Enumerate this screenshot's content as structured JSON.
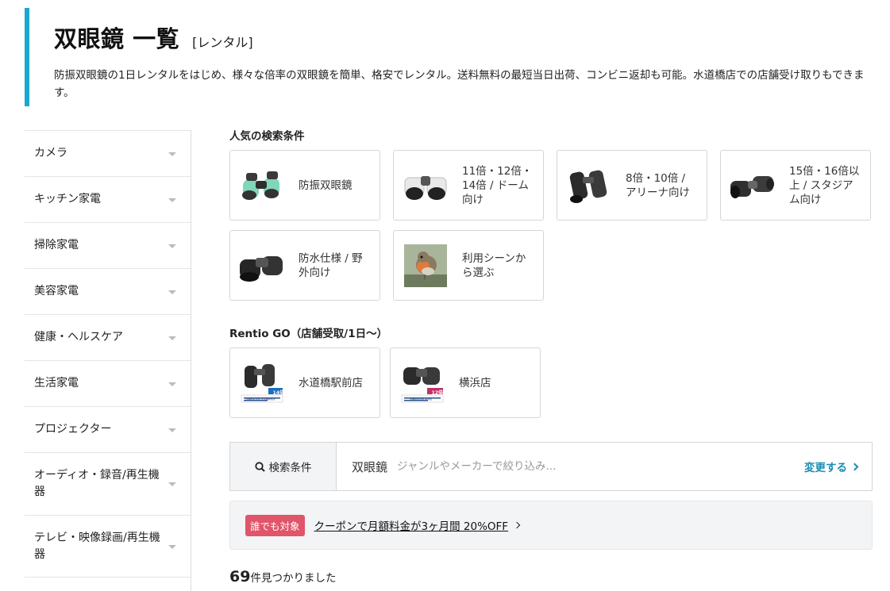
{
  "header": {
    "title": "双眼鏡 一覧",
    "tag": "[レンタル]",
    "description": "防振双眼鏡の1日レンタルをはじめ、様々な倍率の双眼鏡を簡単、格安でレンタル。送料無料の最短当日出荷、コンビニ返却も可能。水道橋店での店舗受け取りもできます。",
    "accent_color": "#1aa7d0"
  },
  "sidebar": {
    "items": [
      {
        "label": "カメラ"
      },
      {
        "label": "キッチン家電"
      },
      {
        "label": "掃除家電"
      },
      {
        "label": "美容家電"
      },
      {
        "label": "健康・ヘルスケア"
      },
      {
        "label": "生活家電"
      },
      {
        "label": "プロジェクター"
      },
      {
        "label": "オーディオ・録音/再生機器"
      },
      {
        "label": "テレビ・映像録画/再生機器"
      }
    ]
  },
  "popular": {
    "title": "人気の検索条件",
    "cards": [
      {
        "label": "防振双眼鏡",
        "icon": "binoculars-mint-icon"
      },
      {
        "label": "11倍・12倍・14倍 / ドーム向け",
        "icon": "binoculars-white-icon"
      },
      {
        "label": "8倍・10倍 / アリーナ向け",
        "icon": "binoculars-black-icon"
      },
      {
        "label": "15倍・16倍以上 / スタジアム向け",
        "icon": "binoculars-black-icon"
      },
      {
        "label": "防水仕様 / 野外向け",
        "icon": "binoculars-black-icon"
      },
      {
        "label": "利用シーンから選ぶ",
        "icon": "bird-photo"
      }
    ]
  },
  "rentio_go": {
    "title": "Rentio GO（店舗受取/1日～）",
    "stores": [
      {
        "label": "水道橋駅前店",
        "badge": "14倍",
        "caption": "店舗受取専用 水道橋駅前店"
      },
      {
        "label": "横浜店",
        "badge": "12倍",
        "caption": "店舗受取専用 横浜店"
      }
    ]
  },
  "search": {
    "label": "検索条件",
    "value": "双眼鏡",
    "placeholder": "ジャンルやメーカーで絞り込み...",
    "change_label": "変更する",
    "link_color": "#1a8db5"
  },
  "coupon": {
    "badge": "誰でも対象",
    "text": "クーポンで月額料金が3ヶ月間 20%OFF",
    "badge_color": "#e0556a"
  },
  "results": {
    "count": "69",
    "suffix": "件見つかりました"
  }
}
